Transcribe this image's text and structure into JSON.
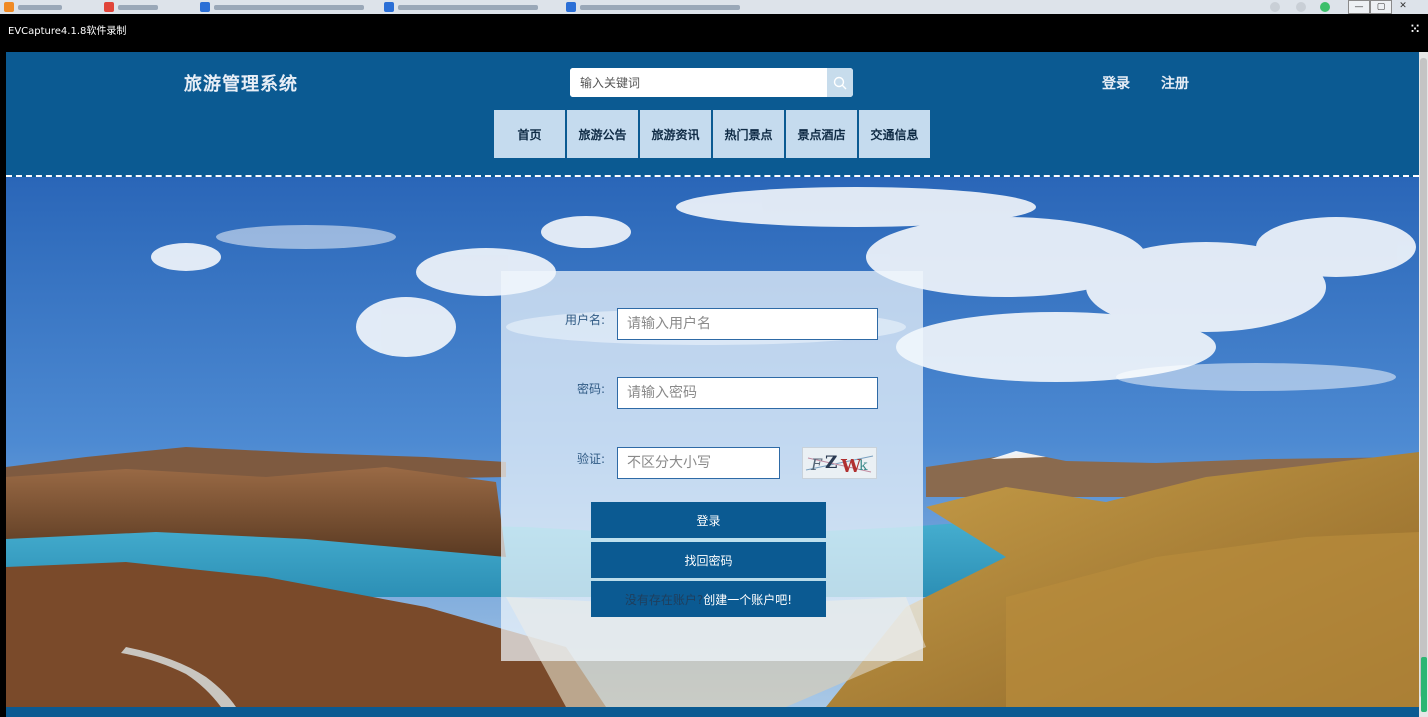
{
  "recorder": {
    "title": "EVCapture4.1.8软件录制",
    "grip_icon": "grid-dots-icon"
  },
  "header": {
    "logo": "旅游管理系统",
    "search_placeholder": "输入关键词",
    "login_link": "登录",
    "register_link": "注册"
  },
  "nav": {
    "items": [
      "首页",
      "旅游公告",
      "旅游资讯",
      "热门景点",
      "景点酒店",
      "交通信息"
    ]
  },
  "login_form": {
    "username_label": "用户名:",
    "username_placeholder": "请输入用户名",
    "password_label": "密码:",
    "password_placeholder": "请输入密码",
    "captcha_label": "验证:",
    "captcha_placeholder": "不区分大小写",
    "captcha_text": "FZWk",
    "login_button": "登录",
    "recover_button": "找回密码",
    "register_prompt": "没有存在账户?",
    "register_action": "创建一个账户吧!"
  },
  "colors": {
    "brand": "#0b5a92",
    "nav_bg": "#c5dbee"
  }
}
